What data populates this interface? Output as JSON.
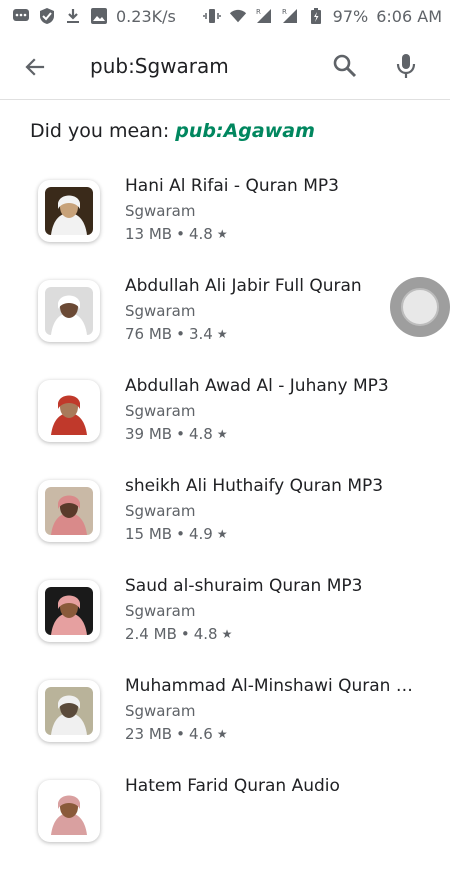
{
  "status_bar": {
    "speed": "0.23K/s",
    "battery": "97%",
    "time": "6:06 AM",
    "left_icons": [
      "chat-icon",
      "shield-icon",
      "download-icon",
      "image-icon"
    ],
    "right_icons": [
      "vibrate-icon",
      "wifi-icon",
      "signal-icon",
      "signal-icon",
      "battery-icon"
    ]
  },
  "search": {
    "query": "pub:Sgwaram"
  },
  "did_you_mean": {
    "label": "Did you mean:",
    "suggestion": "pub:Agawam"
  },
  "apps": [
    {
      "title": "Hani Al Rifai - Quran MP3",
      "developer": "Sgwaram",
      "size": "13 MB",
      "rating": "4.8",
      "icon_colors": [
        "#3a2a1a",
        "#f2f2f2",
        "#c7a27a"
      ]
    },
    {
      "title": "Abdullah Ali Jabir Full Quran",
      "developer": "Sgwaram",
      "size": "76 MB",
      "rating": "3.4",
      "icon_colors": [
        "#dcdcdc",
        "#ffffff",
        "#6b4a35"
      ]
    },
    {
      "title": "Abdullah Awad Al - Juhany MP3",
      "developer": "Sgwaram",
      "size": "39 MB",
      "rating": "4.8",
      "icon_colors": [
        "#ffffff",
        "#c0392b",
        "#a87a5a"
      ]
    },
    {
      "title": "sheikh Ali Huthaify Quran MP3",
      "developer": "Sgwaram",
      "size": "15 MB",
      "rating": "4.9",
      "icon_colors": [
        "#c9b9a6",
        "#d98a8a",
        "#5a3a2a"
      ]
    },
    {
      "title": "Saud al-shuraim Quran MP3",
      "developer": "Sgwaram",
      "size": "2.4 MB",
      "rating": "4.8",
      "icon_colors": [
        "#1a1a1a",
        "#e6a0a0",
        "#8a5a3a"
      ]
    },
    {
      "title": "Muhammad Al-Minshawi Quran M..",
      "developer": "Sgwaram",
      "size": "23 MB",
      "rating": "4.6",
      "icon_colors": [
        "#b9b39a",
        "#f0f0f0",
        "#5a4a3a"
      ]
    },
    {
      "title": "Hatem Farid Quran Audio",
      "developer": "",
      "size": "",
      "rating": "",
      "icon_colors": [
        "#ffffff",
        "#d9a0a0",
        "#8a5a3a"
      ]
    }
  ],
  "colors": {
    "accent": "#01875f",
    "text_primary": "#202124",
    "text_secondary": "#5f6368"
  }
}
